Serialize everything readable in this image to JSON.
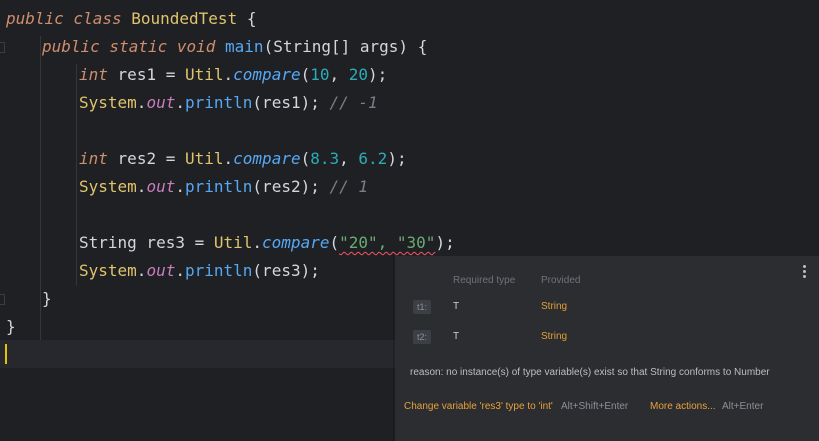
{
  "code": {
    "l1": {
      "kw": "public class",
      "name": "BoundedTest",
      "brace": "{"
    },
    "l2": {
      "kw": "public static void",
      "fn": "main",
      "params": "(String[] args)",
      "brace": "{"
    },
    "l3": {
      "type": "int",
      "rest": "res1 = ",
      "cls": "Util",
      "dot": ".",
      "method": "compare",
      "open": "(",
      "a": "10",
      "comma": ", ",
      "b": "20",
      "close": ");"
    },
    "l4": {
      "cls": "System",
      "dot1": ".",
      "field": "out",
      "dot2": ".",
      "method": "println",
      "args": "(res1);",
      "comment": "// -1"
    },
    "l5": {
      "type": "int",
      "rest": "res2 = ",
      "cls": "Util",
      "dot": ".",
      "method": "compare",
      "open": "(",
      "a": "8.3",
      "comma": ", ",
      "b": "6.2",
      "close": ");"
    },
    "l6": {
      "cls": "System",
      "dot1": ".",
      "field": "out",
      "dot2": ".",
      "method": "println",
      "args": "(res2);",
      "comment": "// 1"
    },
    "l7": {
      "type": "String",
      "rest": " res3 = ",
      "cls": "Util",
      "dot": ".",
      "method": "compare",
      "open": "(",
      "args": "\"20\", \"30\"",
      "close": ");"
    },
    "l8": {
      "cls": "System",
      "dot1": ".",
      "field": "out",
      "dot2": ".",
      "method": "println",
      "args": "(res3);"
    },
    "l9": {
      "brace": "}"
    },
    "l10": {
      "brace": "}"
    }
  },
  "popup": {
    "header_required": "Required type",
    "header_provided": "Provided",
    "rows": [
      {
        "chip": "t1:",
        "required": "T",
        "provided": "String"
      },
      {
        "chip": "t2:",
        "required": "T",
        "provided": "String"
      }
    ],
    "reason": "reason: no instance(s) of type variable(s) exist so that String conforms to Number",
    "action1_label": "Change variable 'res3' type to 'int'",
    "action1_shortcut": "Alt+Shift+Enter",
    "action2_label": "More actions...",
    "action2_shortcut": "Alt+Enter"
  },
  "colors": {
    "background": "#1f2023",
    "keyword": "#cf8e6d",
    "method": "#56a8f5",
    "number": "#2aacb8",
    "string": "#6aab73",
    "action": "#e8a13a"
  }
}
